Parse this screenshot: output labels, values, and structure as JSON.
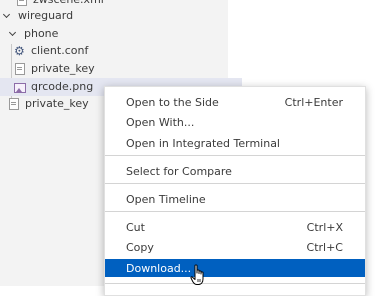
{
  "explorer": {
    "items": [
      {
        "label": "zwscene.xml",
        "kind": "file"
      },
      {
        "label": "wireguard",
        "kind": "folder"
      },
      {
        "label": "phone",
        "kind": "folder"
      },
      {
        "label": "client.conf",
        "kind": "gear"
      },
      {
        "label": "private_key",
        "kind": "file"
      },
      {
        "label": "qrcode.png",
        "kind": "image",
        "selected": true
      },
      {
        "label": "private_key",
        "kind": "file"
      }
    ]
  },
  "context_menu": {
    "items": [
      {
        "label": "Open to the Side",
        "shortcut": "Ctrl+Enter"
      },
      {
        "label": "Open With...",
        "shortcut": ""
      },
      {
        "label": "Open in Integrated Terminal",
        "shortcut": ""
      },
      {
        "label": "Select for Compare",
        "shortcut": ""
      },
      {
        "label": "Open Timeline",
        "shortcut": ""
      },
      {
        "label": "Cut",
        "shortcut": "Ctrl+X"
      },
      {
        "label": "Copy",
        "shortcut": "Ctrl+C"
      },
      {
        "label": "Download...",
        "shortcut": "",
        "active": true
      }
    ]
  },
  "colors": {
    "explorer_bg": "#f3f3f3",
    "selected_row": "#e4e6f1",
    "menu_highlight": "#0060c0"
  }
}
